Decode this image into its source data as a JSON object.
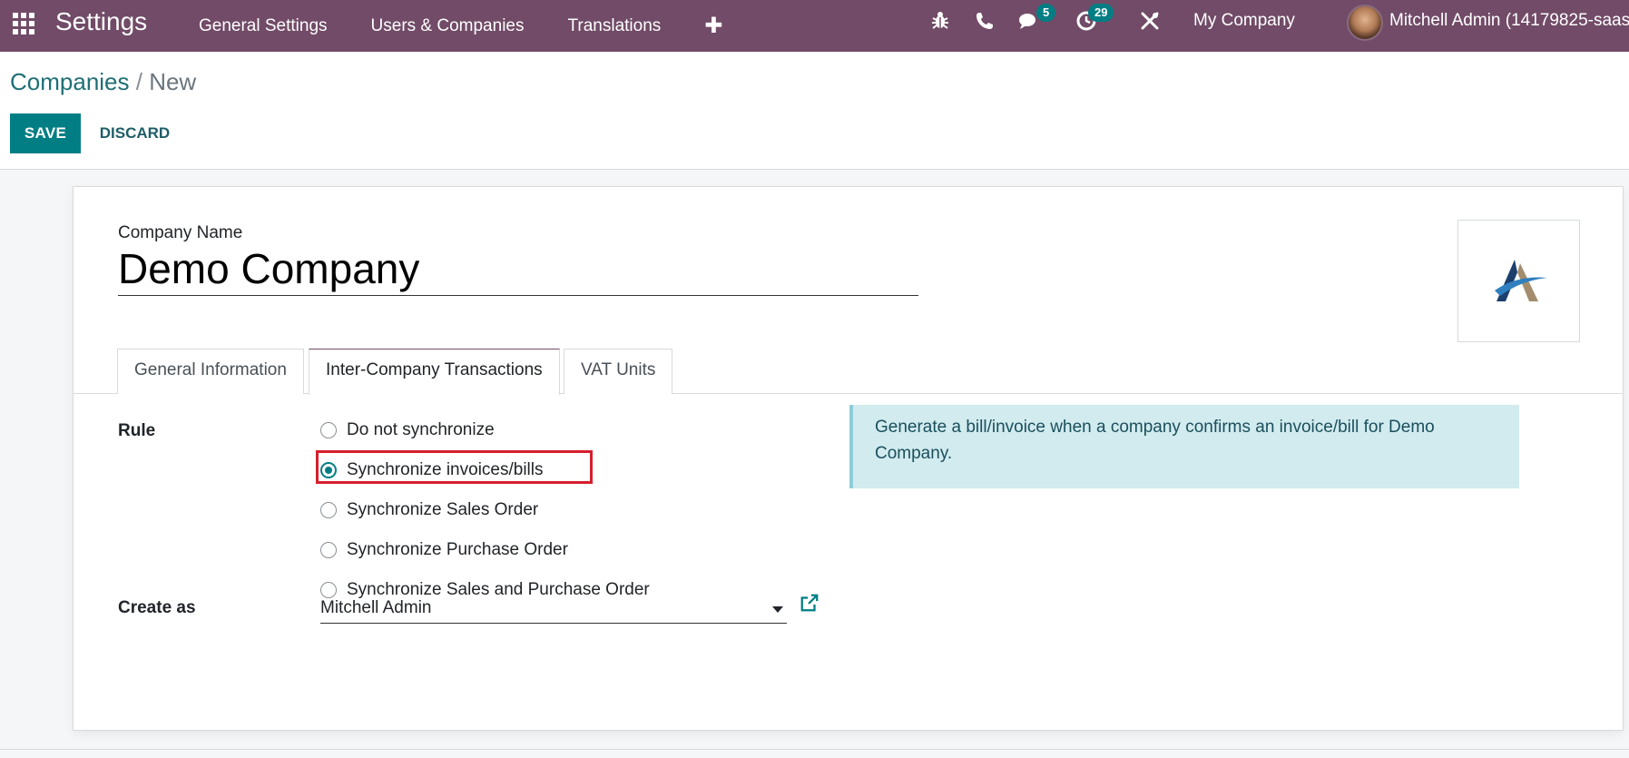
{
  "navbar": {
    "app_title": "Settings",
    "menu": [
      "General Settings",
      "Users & Companies",
      "Translations"
    ],
    "add_symbol": "✚",
    "messages_count": "5",
    "activities_count": "29",
    "company": "My Company",
    "user": "Mitchell Admin (14179825-saas"
  },
  "breadcrumb": {
    "parent": "Companies",
    "separator": " / ",
    "current": "New"
  },
  "actions": {
    "save": "SAVE",
    "discard": "DISCARD"
  },
  "form": {
    "company_name_label": "Company Name",
    "company_name": "Demo Company",
    "tabs": [
      "General Information",
      "Inter-Company Transactions",
      "VAT Units"
    ],
    "active_tab": "Inter-Company Transactions",
    "rule_label": "Rule",
    "rule_options": [
      "Do not synchronize",
      "Synchronize invoices/bills",
      "Synchronize Sales Order",
      "Synchronize Purchase Order",
      "Synchronize Sales and Purchase Order"
    ],
    "selected_rule": "Synchronize invoices/bills",
    "info_text": "Generate a bill/invoice when a company confirms an invoice/bill for Demo Company.",
    "create_as_label": "Create as",
    "create_as_value": "Mitchell Admin"
  },
  "colors": {
    "navbar": "#714b67",
    "primary": "#017e84",
    "highlight": "#d61f2c",
    "alert_bg": "#d1ebef"
  }
}
